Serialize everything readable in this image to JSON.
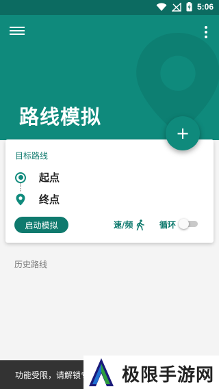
{
  "status_bar": {
    "time": "5:06"
  },
  "header": {
    "title": "路线模拟"
  },
  "route_card": {
    "title": "目标路线",
    "start_label": "起点",
    "end_label": "终点",
    "start_button": "启动模拟",
    "speed_label": "速/频",
    "loop_label": "循环",
    "loop_enabled": false
  },
  "history": {
    "title": "历史路线"
  },
  "toast": {
    "message": "功能受限，请解锁专"
  },
  "brand": {
    "text": "极限手游网"
  },
  "colors": {
    "primary": "#0f8a7c",
    "primary_dark": "#0c6b61",
    "accent_text": "#0f7a6e"
  },
  "fab": {
    "icon": "plus-icon"
  }
}
